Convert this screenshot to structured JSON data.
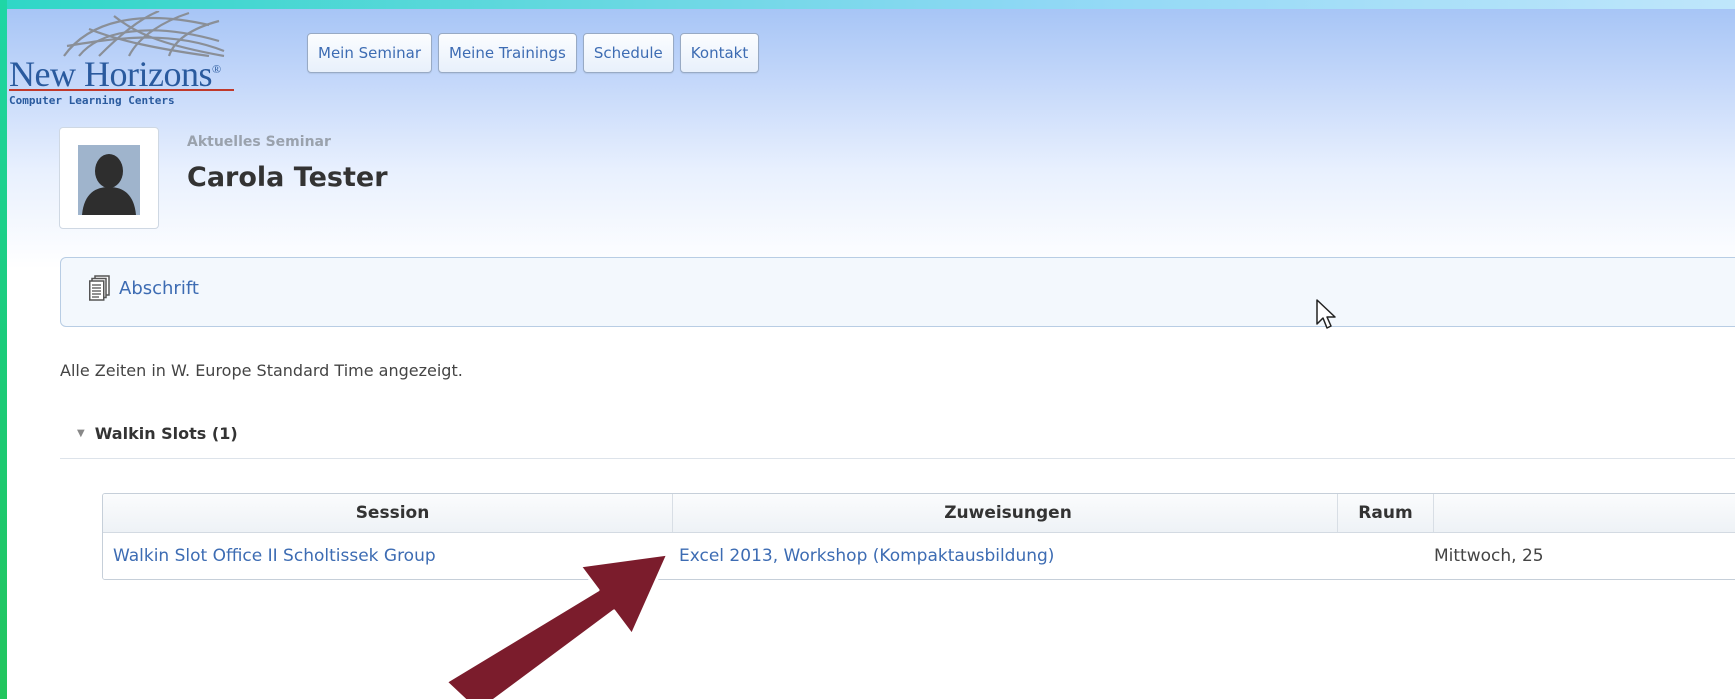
{
  "logo": {
    "name": "New Horizons",
    "registered_mark": "®",
    "tagline": "Computer Learning Centers"
  },
  "nav": {
    "items": [
      {
        "label": "Mein Seminar"
      },
      {
        "label": "Meine Trainings"
      },
      {
        "label": "Schedule"
      },
      {
        "label": "Kontakt"
      }
    ]
  },
  "user": {
    "subtitle": "Aktuelles Seminar",
    "name": "Carola Tester"
  },
  "transcript": {
    "icon": "document-stack-icon",
    "label": "Abschrift"
  },
  "timezone_note": "Alle Zeiten in W. Europe Standard Time angezeigt.",
  "section": {
    "title": "Walkin Slots (1)",
    "toggle_icon": "triangle-down-icon"
  },
  "table": {
    "headers": [
      "Session",
      "Zuweisungen",
      "Raum",
      ""
    ],
    "rows": [
      {
        "session": "Walkin Slot Office II Scholtissek Group",
        "assignment": "Excel 2013, Workshop (Kompaktausbildung)",
        "room": "",
        "date": "Mittwoch, 25"
      }
    ]
  },
  "colors": {
    "link": "#3d6cb3",
    "header_gradient_top": "#a7c5f6",
    "annotation_arrow": "#7b1c2c",
    "frame_left": "#1bcc7a"
  }
}
